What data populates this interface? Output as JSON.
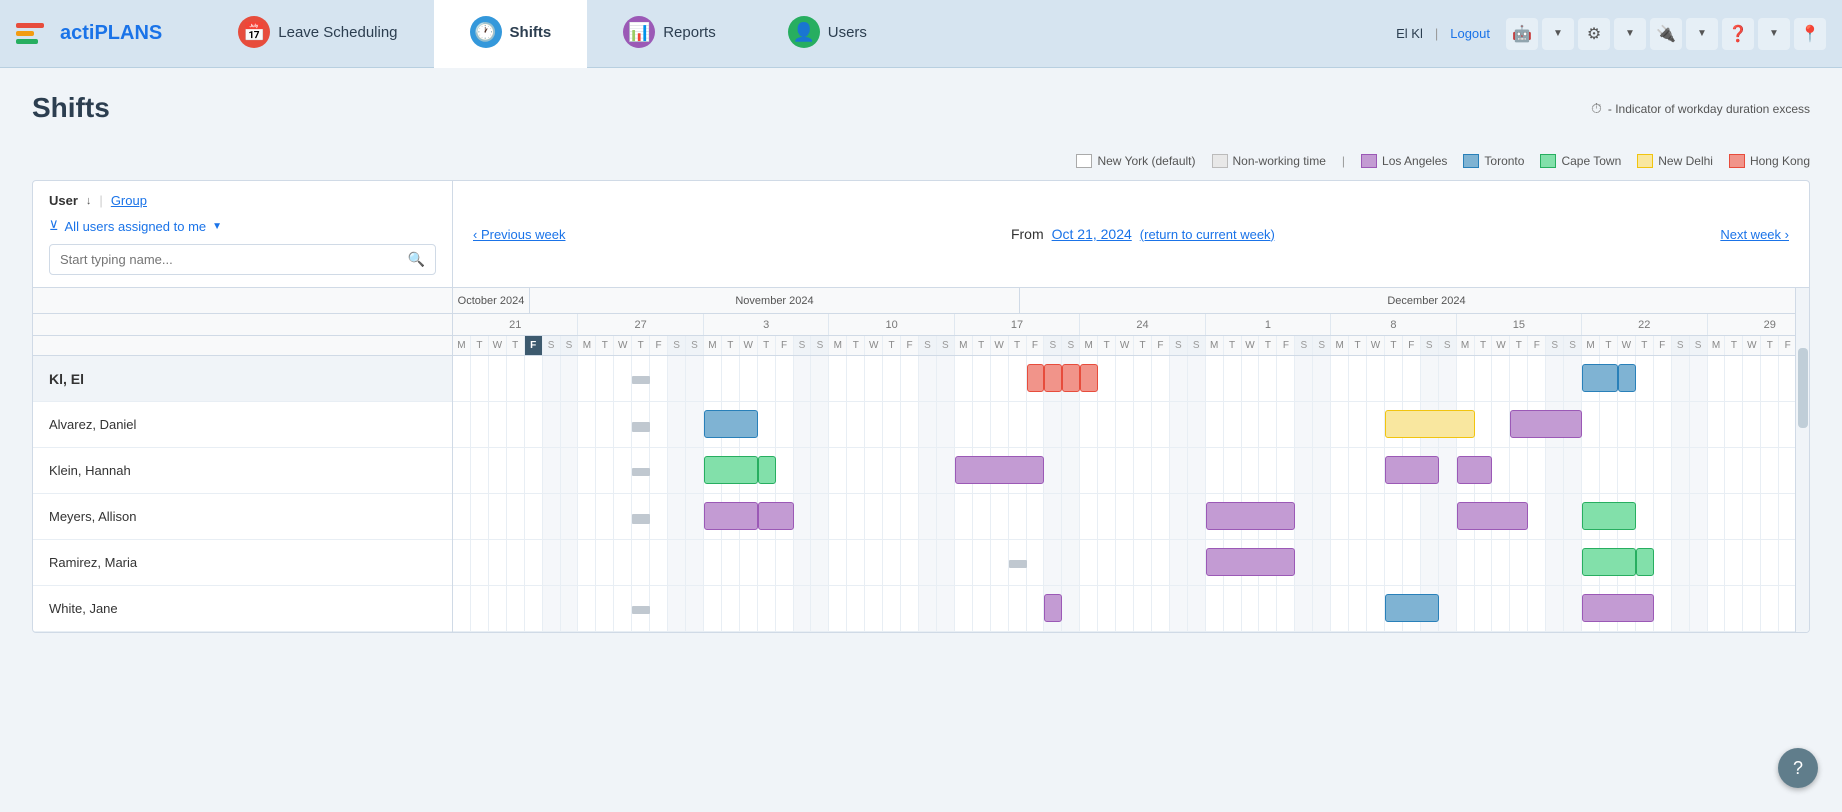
{
  "app": {
    "name_prefix": "acti",
    "name_suffix": "PLANS"
  },
  "header": {
    "user": "El Kl",
    "logout": "Logout",
    "nav_tabs": [
      {
        "id": "leave",
        "label": "Leave Scheduling",
        "icon": "📅",
        "icon_class": "leave"
      },
      {
        "id": "shifts",
        "label": "Shifts",
        "icon": "🕐",
        "icon_class": "shifts",
        "active": true
      },
      {
        "id": "reports",
        "label": "Reports",
        "icon": "📊",
        "icon_class": "reports"
      },
      {
        "id": "users",
        "label": "Users",
        "icon": "👤",
        "icon_class": "users"
      }
    ]
  },
  "page": {
    "title": "Shifts",
    "indicator_label": "- Indicator of workday duration excess"
  },
  "legend": {
    "items": [
      {
        "id": "new_york",
        "label": "New York (default)",
        "color": "#ffffff",
        "border": "#aaa"
      },
      {
        "id": "non_working",
        "label": "Non-working time",
        "color": "#e8e8e8",
        "border": "#bbb"
      },
      {
        "id": "los_angeles",
        "label": "Los Angeles",
        "color": "#c39bd3",
        "border": "#9b59b6"
      },
      {
        "id": "toronto",
        "label": "Toronto",
        "color": "#7fb3d3",
        "border": "#2980b9"
      },
      {
        "id": "cape_town",
        "label": "Cape Town",
        "color": "#82e0aa",
        "border": "#27ae60"
      },
      {
        "id": "new_delhi",
        "label": "New Delhi",
        "color": "#f9e79f",
        "border": "#f1c40f"
      },
      {
        "id": "hong_kong",
        "label": "Hong Kong",
        "color": "#f1948a",
        "border": "#e74c3c"
      }
    ]
  },
  "filter": {
    "sort_by": "User",
    "sort_arrow": "↓",
    "group_label": "Group",
    "filter_label": "All users assigned to me",
    "search_placeholder": "Start typing name...",
    "prev_week": "‹ Previous week",
    "next_week": "Next week ›",
    "from_label": "From",
    "date_label": "Oct 21, 2024",
    "return_label": "(return to current week)"
  },
  "users": [
    {
      "name": "Kl, El",
      "is_header": true
    },
    {
      "name": "Alvarez, Daniel",
      "is_header": false
    },
    {
      "name": "Klein, Hannah",
      "is_header": false
    },
    {
      "name": "Meyers, Allison",
      "is_header": false
    },
    {
      "name": "Ramirez, Maria",
      "is_header": false
    },
    {
      "name": "White, Jane",
      "is_header": false
    }
  ],
  "calendar": {
    "months": [
      {
        "label": "October 2024",
        "span": 11
      },
      {
        "label": "November 2024",
        "span": 35
      },
      {
        "label": "December 2024",
        "span": 27
      }
    ],
    "week_starts": [
      "21",
      "27",
      "3",
      "10",
      "17",
      "24",
      "1",
      "8",
      "15",
      "22",
      "29"
    ],
    "total_days": 73
  }
}
